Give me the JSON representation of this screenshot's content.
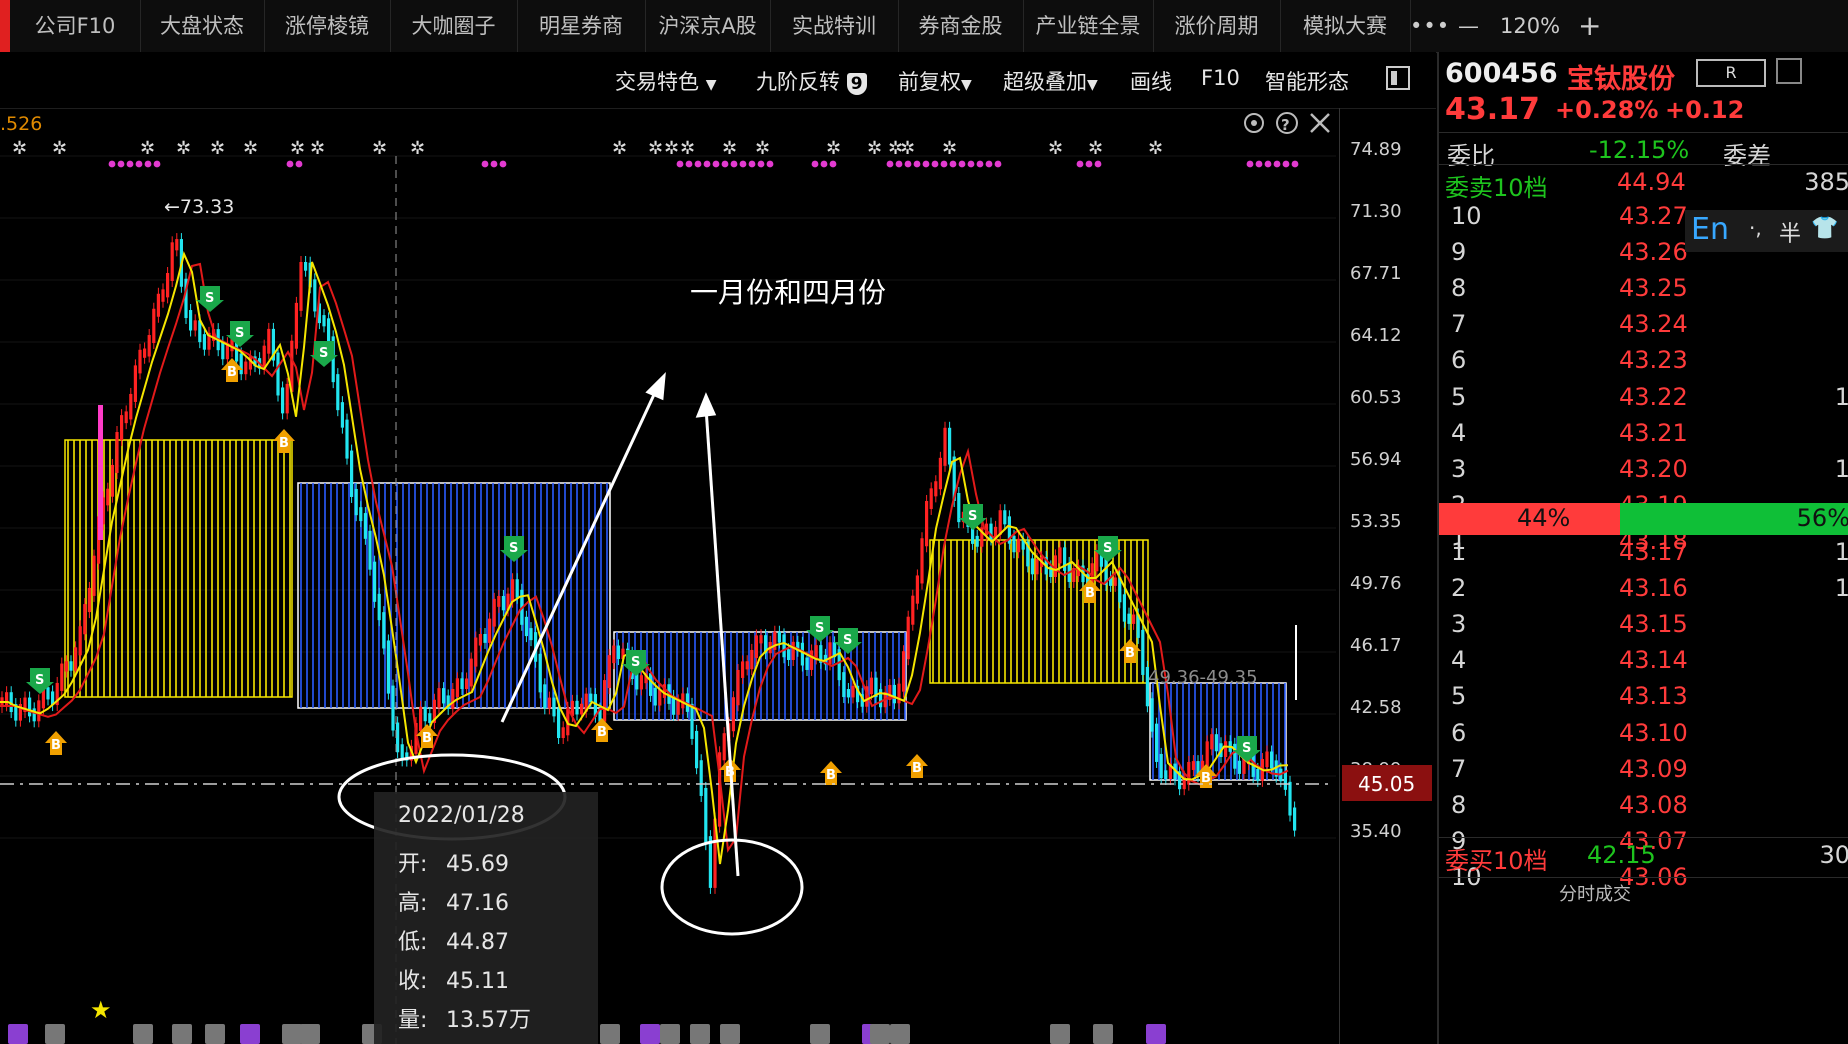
{
  "nav": {
    "tabs": [
      "公司F10",
      "大盘状态",
      "涨停棱镜",
      "大咖圈子",
      "明星券商",
      "沪深京A股",
      "实战特训",
      "券商金股",
      "产业链全景",
      "涨价周期",
      "模拟大赛"
    ],
    "more": "•••",
    "minimize": "—",
    "zoom": "120%",
    "add": "+"
  },
  "toolbar": {
    "trade_features": "交易特色",
    "nine_reversal": "九阶反转",
    "nine_badge": "9",
    "adjust": "前复权",
    "overlay": "超级叠加",
    "draw": "画线",
    "f10": "F10",
    "smart": "智能形态"
  },
  "chart": {
    "top_left_value": ".526",
    "y_ticks": [
      "74.89",
      "71.30",
      "67.71",
      "64.12",
      "60.53",
      "56.94",
      "53.35",
      "49.76",
      "46.17",
      "42.58",
      "38.99",
      "35.40"
    ],
    "current_price_tag": "45.05",
    "high_marker": "←73.33",
    "annotation": "一月份和四月份",
    "box_label": "49.36-49.35",
    "tooltip": {
      "date": "2022/01/28",
      "open_label": "开:",
      "open": "45.69",
      "high_label": "高:",
      "high": "47.16",
      "low_label": "低:",
      "low": "44.87",
      "close_label": "收:",
      "close": "45.11",
      "volume_label": "量:",
      "volume": "13.57万"
    },
    "colors": {
      "up": "#ff2222",
      "down": "#22e5f0",
      "ma_yellow": "#f5e600",
      "ma_red": "#e21a1a",
      "box_blue": "#2a5cff",
      "box_yellow": "#f5e600",
      "buy": "#f0a000",
      "sell": "#1aa84a"
    }
  },
  "quote": {
    "code": "600456",
    "name": "宝钛股份",
    "r_badge": "R",
    "price": "43.17",
    "change_pct": "+0.28%",
    "change": "+0.12",
    "weibi_label": "委比",
    "weibi_value": "-12.15%",
    "weicha_label": "委差",
    "sell_header_label": "委卖10档",
    "sell_header_price": "44.94",
    "sell_header_vol": "385",
    "sell_levels": [
      {
        "level": "10",
        "price": "43.27",
        "vol": ""
      },
      {
        "level": "9",
        "price": "43.26",
        "vol": ""
      },
      {
        "level": "8",
        "price": "43.25",
        "vol": ""
      },
      {
        "level": "7",
        "price": "43.24",
        "vol": ""
      },
      {
        "level": "6",
        "price": "43.23",
        "vol": ""
      },
      {
        "level": "5",
        "price": "43.22",
        "vol": "1"
      },
      {
        "level": "4",
        "price": "43.21",
        "vol": ""
      },
      {
        "level": "3",
        "price": "43.20",
        "vol": "1"
      },
      {
        "level": "2",
        "price": "43.19",
        "vol": ""
      },
      {
        "level": "1",
        "price": "43.18",
        "vol": ""
      }
    ],
    "ratio_sell": "44%",
    "ratio_buy": "56%",
    "ratio_sell_fraction": 0.44,
    "buy_levels": [
      {
        "level": "1",
        "price": "43.17",
        "vol": "1"
      },
      {
        "level": "2",
        "price": "43.16",
        "vol": "1"
      },
      {
        "level": "3",
        "price": "43.15",
        "vol": ""
      },
      {
        "level": "4",
        "price": "43.14",
        "vol": ""
      },
      {
        "level": "5",
        "price": "43.13",
        "vol": ""
      },
      {
        "level": "6",
        "price": "43.10",
        "vol": ""
      },
      {
        "level": "7",
        "price": "43.09",
        "vol": ""
      },
      {
        "level": "8",
        "price": "43.08",
        "vol": ""
      },
      {
        "level": "9",
        "price": "43.07",
        "vol": ""
      },
      {
        "level": "10",
        "price": "43.06",
        "vol": ""
      }
    ],
    "buy_header_label": "委买10档",
    "buy_header_price": "42.15",
    "buy_header_vol": "30",
    "bottom_text": "分时成交",
    "ime": {
      "en": "En",
      "punct": "·,",
      "half": "半",
      "shirt_icon": "shirt-icon"
    }
  }
}
